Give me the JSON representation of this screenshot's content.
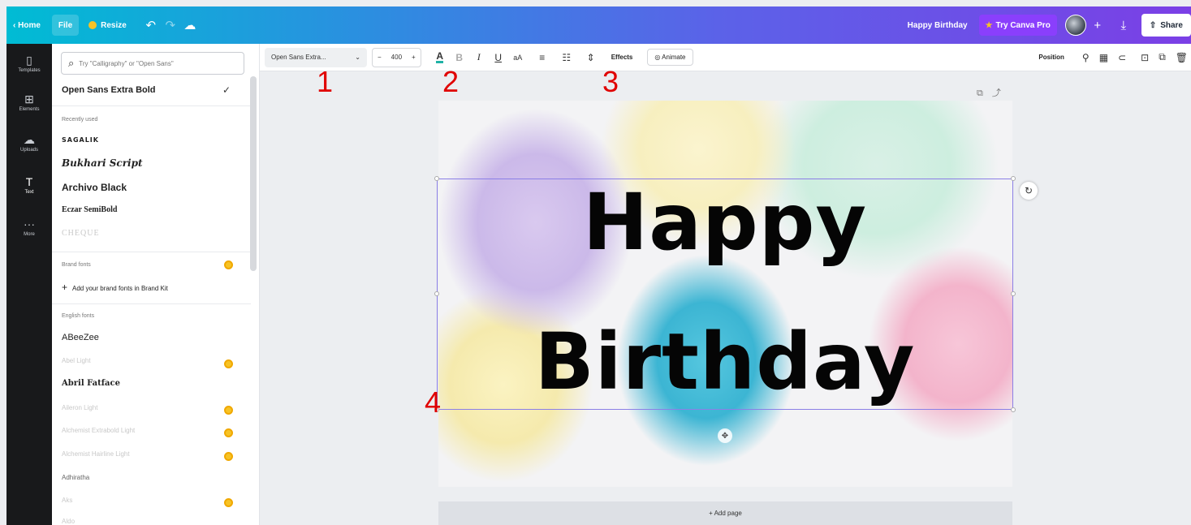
{
  "topbar": {
    "home": "Home",
    "file": "File",
    "resize": "Resize",
    "undo_icon": "undo-icon",
    "redo_icon": "redo-icon",
    "cloud_icon": "cloud-icon",
    "doc_title": "Happy Birthday",
    "try_pro": "Try Canva Pro",
    "share": "Share"
  },
  "rail": {
    "items": [
      {
        "label": "Templates",
        "icon": "▯"
      },
      {
        "label": "Elements",
        "icon": "⊞"
      },
      {
        "label": "Uploads",
        "icon": "☁"
      },
      {
        "label": "Text",
        "icon": "T"
      },
      {
        "label": "More",
        "icon": "···"
      }
    ]
  },
  "panel": {
    "search_placeholder": "Try \"Calligraphy\" or \"Open Sans\"",
    "current_font": "Open Sans Extra Bold",
    "recent_heading": "Recently used",
    "recent": [
      "SAGALIK",
      "Bukhari Script",
      "Archivo Black",
      "Eczar SemiBold",
      "CHEQUE"
    ],
    "brand_heading": "Brand fonts",
    "brand_add": "Add your brand fonts in Brand Kit",
    "english_heading": "English fonts",
    "english": [
      "ABeeZee",
      "Abel Light",
      "Abril Fatface",
      "Aileron Light",
      "Alchemist Extrabold Light",
      "Alchemist Hairline Light",
      "Adhiratha",
      "Aks",
      "Aldo"
    ]
  },
  "format": {
    "font": "Open Sans Extra...",
    "minus": "−",
    "size": "400",
    "plus": "+",
    "text_color": "A",
    "bold": "B",
    "italic": "I",
    "underline": "U",
    "case": "aA",
    "align": "≡",
    "list": "☷",
    "spacing": "⇕",
    "effects": "Effects",
    "animate": "Animate",
    "position": "Position"
  },
  "canvas": {
    "line1": "Happy",
    "line2": "Birthday",
    "add_page": "+ Add page"
  },
  "annotations": [
    "1",
    "2",
    "3",
    "4"
  ],
  "colors": {
    "accent": "#8b7fe6",
    "text_color_underline": "#1fb2a6",
    "pro_purple": "#8a3ffc",
    "crown_gold": "#f7c325",
    "annotation_red": "#e00000"
  }
}
